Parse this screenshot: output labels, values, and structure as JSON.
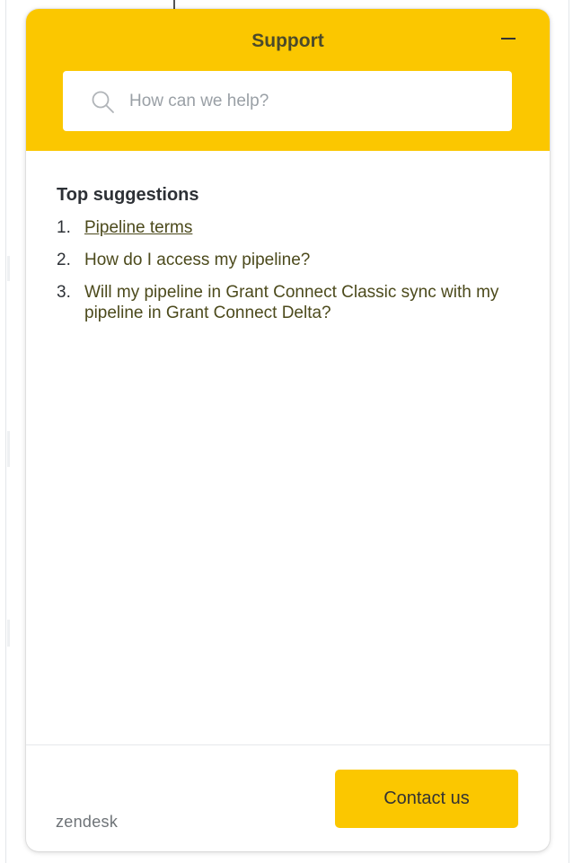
{
  "widget": {
    "title": "Support",
    "minimize_icon": "minimize-icon",
    "accent_color": "#fbc700"
  },
  "search": {
    "icon": "search-icon",
    "placeholder": "How can we help?",
    "value": ""
  },
  "suggestions": {
    "heading": "Top suggestions",
    "items": [
      {
        "number": "1.",
        "label": "Pipeline terms"
      },
      {
        "number": "2.",
        "label": "How do I access my pipeline?"
      },
      {
        "number": "3.",
        "label": "Will my pipeline in Grant Connect Classic sync with my pipeline in Grant Connect Delta?"
      }
    ]
  },
  "footer": {
    "brand": "zendesk",
    "contact_label": "Contact us"
  }
}
